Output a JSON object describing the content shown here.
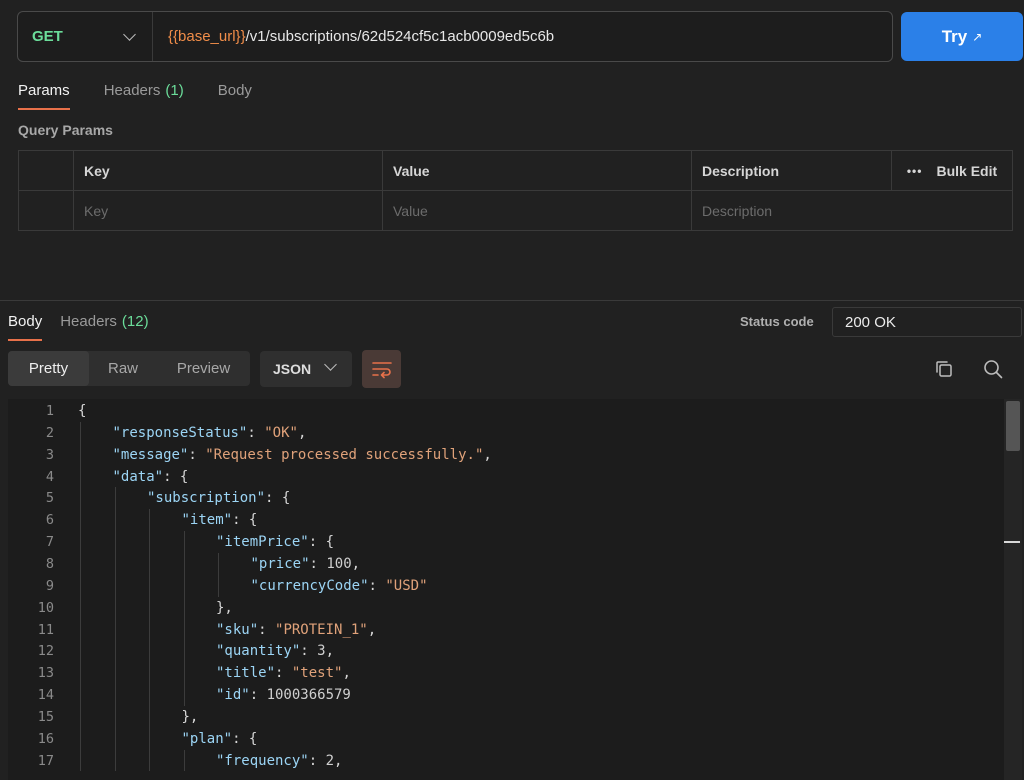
{
  "request": {
    "method": "GET",
    "url_var": "{{base_url}}",
    "url_path": "/v1/subscriptions/62d524cf5c1acb0009ed5c6b",
    "try_label": "Try",
    "try_arrow": "↗"
  },
  "request_tabs": [
    {
      "label": "Params"
    },
    {
      "label": "Headers",
      "count": "(1)"
    },
    {
      "label": "Body"
    }
  ],
  "query_params": {
    "title": "Query Params",
    "headers": {
      "key": "Key",
      "value": "Value",
      "description": "Description",
      "bulk_edit": "Bulk Edit",
      "dots": "•••"
    },
    "placeholders": {
      "key": "Key",
      "value": "Value",
      "description": "Description"
    }
  },
  "response": {
    "tabs": [
      {
        "label": "Body"
      },
      {
        "label": "Headers",
        "count": "(12)"
      }
    ],
    "status_label": "Status code",
    "status_value": "200 OK",
    "view_modes": [
      "Pretty",
      "Raw",
      "Preview"
    ],
    "format": "JSON",
    "active_view": "Pretty"
  },
  "code_lines": [
    {
      "n": "1",
      "indent": 0,
      "parts": [
        [
          "p",
          "{"
        ]
      ]
    },
    {
      "n": "2",
      "indent": 1,
      "parts": [
        [
          "k",
          "\"responseStatus\""
        ],
        [
          "p",
          ": "
        ],
        [
          "s",
          "\"OK\""
        ],
        [
          "p",
          ","
        ]
      ]
    },
    {
      "n": "3",
      "indent": 1,
      "parts": [
        [
          "k",
          "\"message\""
        ],
        [
          "p",
          ": "
        ],
        [
          "s",
          "\"Request processed successfully.\""
        ],
        [
          "p",
          ","
        ]
      ]
    },
    {
      "n": "4",
      "indent": 1,
      "parts": [
        [
          "k",
          "\"data\""
        ],
        [
          "p",
          ": {"
        ]
      ]
    },
    {
      "n": "5",
      "indent": 2,
      "parts": [
        [
          "k",
          "\"subscription\""
        ],
        [
          "p",
          ": {"
        ]
      ]
    },
    {
      "n": "6",
      "indent": 3,
      "parts": [
        [
          "k",
          "\"item\""
        ],
        [
          "p",
          ": {"
        ]
      ]
    },
    {
      "n": "7",
      "indent": 4,
      "parts": [
        [
          "k",
          "\"itemPrice\""
        ],
        [
          "p",
          ": {"
        ]
      ]
    },
    {
      "n": "8",
      "indent": 5,
      "parts": [
        [
          "k",
          "\"price\""
        ],
        [
          "p",
          ": "
        ],
        [
          "n",
          "100"
        ],
        [
          "p",
          ","
        ]
      ]
    },
    {
      "n": "9",
      "indent": 5,
      "parts": [
        [
          "k",
          "\"currencyCode\""
        ],
        [
          "p",
          ": "
        ],
        [
          "s",
          "\"USD\""
        ]
      ]
    },
    {
      "n": "10",
      "indent": 4,
      "parts": [
        [
          "p",
          "},"
        ]
      ]
    },
    {
      "n": "11",
      "indent": 4,
      "parts": [
        [
          "k",
          "\"sku\""
        ],
        [
          "p",
          ": "
        ],
        [
          "s",
          "\"PROTEIN_1\""
        ],
        [
          "p",
          ","
        ]
      ]
    },
    {
      "n": "12",
      "indent": 4,
      "parts": [
        [
          "k",
          "\"quantity\""
        ],
        [
          "p",
          ": "
        ],
        [
          "n",
          "3"
        ],
        [
          "p",
          ","
        ]
      ]
    },
    {
      "n": "13",
      "indent": 4,
      "parts": [
        [
          "k",
          "\"title\""
        ],
        [
          "p",
          ": "
        ],
        [
          "s",
          "\"test\""
        ],
        [
          "p",
          ","
        ]
      ]
    },
    {
      "n": "14",
      "indent": 4,
      "parts": [
        [
          "k",
          "\"id\""
        ],
        [
          "p",
          ": "
        ],
        [
          "n",
          "1000366579"
        ]
      ]
    },
    {
      "n": "15",
      "indent": 3,
      "parts": [
        [
          "p",
          "},"
        ]
      ]
    },
    {
      "n": "16",
      "indent": 3,
      "parts": [
        [
          "k",
          "\"plan\""
        ],
        [
          "p",
          ": {"
        ]
      ]
    },
    {
      "n": "17",
      "indent": 4,
      "parts": [
        [
          "k",
          "\"frequency\""
        ],
        [
          "p",
          ": "
        ],
        [
          "n",
          "2"
        ],
        [
          "p",
          ","
        ]
      ]
    }
  ],
  "icons": [
    "chevron-down-icon",
    "external-arrow-icon",
    "more-dots-icon",
    "wrap-lines-icon",
    "copy-icon",
    "search-icon"
  ],
  "colors": {
    "accent": "#e8714a",
    "primary_button": "#2b80e8",
    "method_get": "#6bdd9a",
    "json_key": "#9cd5f5",
    "json_string": "#e0a27a",
    "variable": "#f08d49"
  }
}
